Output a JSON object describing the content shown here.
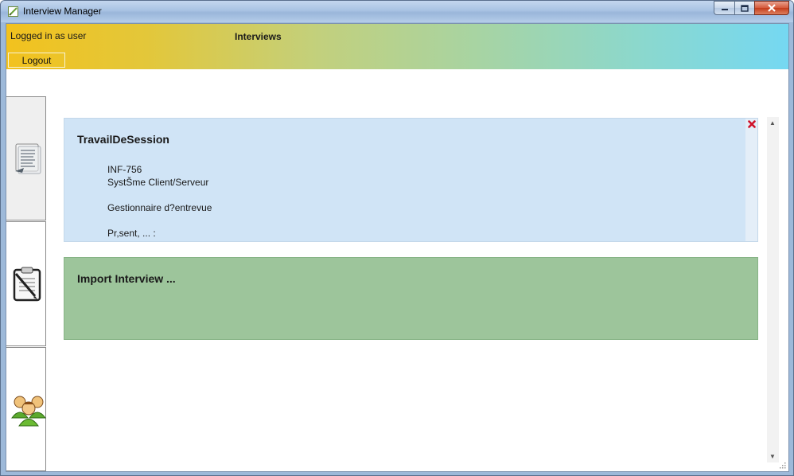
{
  "window": {
    "title": "Interview Manager"
  },
  "header": {
    "logged_in_label": "Logged in as user",
    "logout_label": "Logout",
    "page_title": "Interviews",
    "colors": {
      "gradient_start": "#f2c21e",
      "gradient_end": "#75d8f2"
    }
  },
  "sidebar": {
    "tabs": [
      {
        "icon": "document-list-icon"
      },
      {
        "icon": "clipboard-pencil-icon"
      },
      {
        "icon": "users-group-icon"
      }
    ]
  },
  "cards": {
    "session": {
      "title": "TravailDeSession",
      "lines": [
        "INF-756",
        "SystŠme Client/Serveur",
        "",
        "Gestionnaire d?entrevue",
        "",
        "Pr,sent, ... :"
      ],
      "bg_color": "#d0e4f6",
      "delete_icon": "close-x-icon"
    },
    "import": {
      "title": "Import Interview ...",
      "bg_color": "#9dc59b"
    }
  }
}
